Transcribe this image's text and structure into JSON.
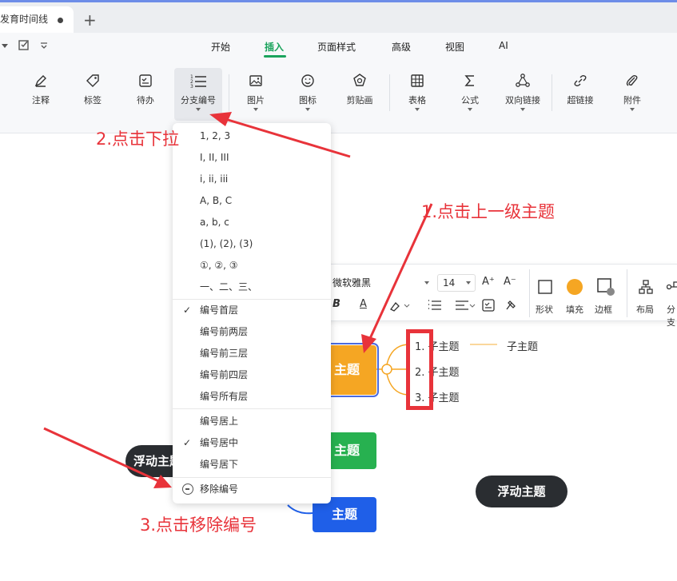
{
  "tabbar": {
    "tab_title": "发育时间线",
    "new_tab": "+"
  },
  "menubar": {
    "items": [
      "开始",
      "插入",
      "页面样式",
      "高级",
      "视图",
      "AI"
    ],
    "active": "插入"
  },
  "ribbon": {
    "tools": [
      "注释",
      "标签",
      "待办",
      "分支编号",
      "图片",
      "图标",
      "剪贴画",
      "表格",
      "公式",
      "双向链接",
      "超链接",
      "附件"
    ]
  },
  "dropdown": {
    "formats": [
      "1, 2, 3",
      "I, II, III",
      "i, ii, iii",
      "A, B, C",
      "a, b, c",
      "(1), (2), (3)",
      "①, ②, ③",
      "一、二、三、"
    ],
    "levels": [
      "编号首层",
      "编号前两层",
      "编号前三层",
      "编号前四层",
      "编号所有层"
    ],
    "alignment": [
      "编号居上",
      "编号居中",
      "编号居下"
    ],
    "remove": "移除编号",
    "checked_level": "编号首层",
    "checked_alignment": "编号居中",
    "check_mark": "✓"
  },
  "format_toolbar": {
    "font": "微软雅黑",
    "size": "14",
    "grow": "A⁺",
    "shrink": "A⁻",
    "bold": "B",
    "font_color": "A",
    "labels": [
      "形状",
      "填充",
      "边框",
      "布局",
      "分支"
    ]
  },
  "mindmap": {
    "main_topic": "主题",
    "green_topic": "主题",
    "blue_topic": "主题",
    "subtopics": [
      "1. 子主题",
      "2. 子主题",
      "3. 子主题"
    ],
    "child": "子主题",
    "float_left": "浮动主题",
    "float_right": "浮动主题"
  },
  "annotations": {
    "step1": "1.点击上一级主题",
    "step2": "2.点击下拉",
    "step3": "3.点击移除编号"
  },
  "colors": {
    "accent": "#1aa35c",
    "orange": "#f5a623",
    "green": "#27b150",
    "blue": "#1f5fe8",
    "annotation": "#e8333a"
  }
}
